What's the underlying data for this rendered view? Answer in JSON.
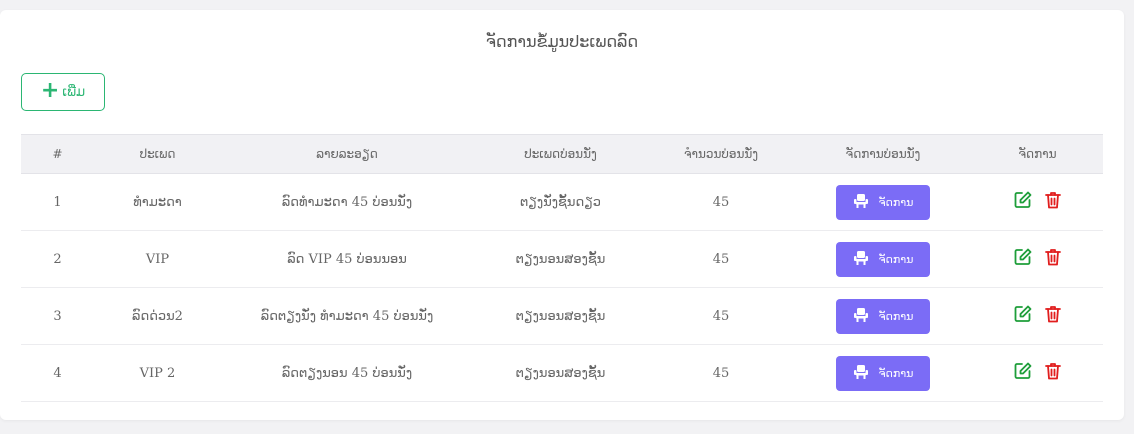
{
  "page": {
    "title": "ຈັດການຂໍ້ມູນປະເພດລົດ"
  },
  "toolbar": {
    "add_label": "ເພີ່ມ"
  },
  "table": {
    "headers": [
      "#",
      "ປະເພດ",
      "ລາຍລະອຽດ",
      "ປະເພດບ່ອນນັ່ງ",
      "ຈຳນວນບ່ອນນັ່ງ",
      "ຈັດການບ່ອນນັ່ງ",
      "ຈັດການ"
    ],
    "rows": [
      {
        "no": "1",
        "type": "ທຳມະດາ",
        "detail": "ລົດທຳມະດາ 45 ບ່ອນນັ່ງ",
        "seat_type": "ຕຽງນັ່ງຊັ້ນດຽວ",
        "seat_count": "45",
        "manage_label": "ຈັດການ"
      },
      {
        "no": "2",
        "type": "VIP",
        "detail": "ລົດ VIP 45 ບ່ອນນອນ",
        "seat_type": "ຕຽງນອນສອງຊັ້ນ",
        "seat_count": "45",
        "manage_label": "ຈັດການ"
      },
      {
        "no": "3",
        "type": "ລົດດ່ວນ2",
        "detail": "ລົດຕຽງນັ່ງ ທຳມະດາ 45 ບ່ອນນັ່ງ",
        "seat_type": "ຕຽງນອນສອງຊັ້ນ",
        "seat_count": "45",
        "manage_label": "ຈັດການ"
      },
      {
        "no": "4",
        "type": "VIP 2",
        "detail": "ລົດຕຽງນອນ 45 ບ່ອນນັ່ງ",
        "seat_type": "ຕຽງນອນສອງຊັ້ນ",
        "seat_count": "45",
        "manage_label": "ຈັດການ"
      }
    ]
  },
  "icons": {
    "add": "plus-icon",
    "seat": "seat-icon",
    "edit": "edit-icon",
    "delete": "trash-icon"
  },
  "colors": {
    "accent_green": "#2bb673",
    "manage_purple": "#7b6cf6",
    "edit_green": "#1e9e3a",
    "delete_red": "#e11d1d"
  }
}
